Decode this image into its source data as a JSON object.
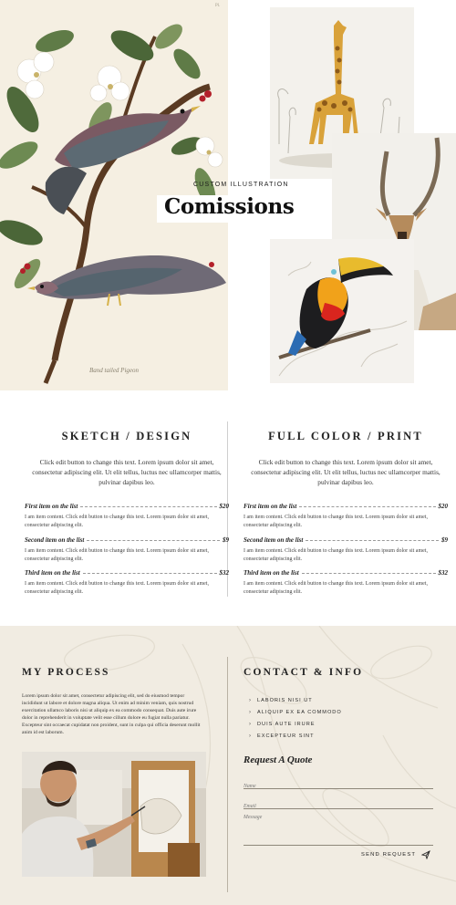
{
  "hero": {
    "kicker": "CUSTOM ILLUSTRATION",
    "title": "Comissions",
    "plate_caption": "Band tailed Pigeon",
    "plate_number": "Pl."
  },
  "pricing": {
    "columns": [
      {
        "title": "SKETCH / DESIGN",
        "intro": "Click edit button to change this text. Lorem ipsum dolor sit amet, consectetur adipiscing elit. Ut elit tellus, luctus nec ullamcorper mattis, pulvinar dapibus leo.",
        "items": [
          {
            "name": "First item on the list",
            "price": "$20",
            "desc": "I am item content. Click edit button to change this text. Lorem ipsum dolor sit amet, consectetur adipiscing elit."
          },
          {
            "name": "Second item on the list",
            "price": "$9",
            "desc": "I am item content. Click edit button to change this text. Lorem ipsum dolor sit amet, consectetur adipiscing elit."
          },
          {
            "name": "Third item on the list",
            "price": "$32",
            "desc": "I am item content. Click edit button to change this text. Lorem ipsum dolor sit amet, consectetur adipiscing elit."
          }
        ]
      },
      {
        "title": "FULL COLOR / PRINT",
        "intro": "Click edit button to change this text. Lorem ipsum dolor sit amet, consectetur adipiscing elit. Ut elit tellus, luctus nec ullamcorper mattis, pulvinar dapibus leo.",
        "items": [
          {
            "name": "First item on the list",
            "price": "$20",
            "desc": "I am item content. Click edit button to change this text. Lorem ipsum dolor sit amet, consectetur adipiscing elit."
          },
          {
            "name": "Second item on the list",
            "price": "$9",
            "desc": "I am item content. Click edit button to change this text. Lorem ipsum dolor sit amet, consectetur adipiscing elit."
          },
          {
            "name": "Third item on the list",
            "price": "$32",
            "desc": "I am item content. Click edit button to change this text. Lorem ipsum dolor sit amet, consectetur adipiscing elit."
          }
        ]
      }
    ]
  },
  "process": {
    "title": "MY PROCESS",
    "body": "Lorem ipsum dolor sit amet, consectetur adipiscing elit, sed do eiusmod tempor incididunt ut labore et dolore magna aliqua. Ut enim ad minim veniam, quis nostrud exercitation ullamco laboris nisi ut aliquip ex ea commodo consequat. Duis aute irure dolor in reprehenderit in voluptate velit esse cillum dolore eu fugiat nulla pariatur. Excepteur sint occaecat cupidatat non proident, sunt in culpa qui officia deserunt mollit anim id est laborum."
  },
  "contact": {
    "title": "CONTACT & INFO",
    "list": [
      "LABORIS NISI UT",
      "ALIQUIP EX EA COMMODO",
      "DUIS AUTE IRURE",
      "EXCEPTEUR SINT"
    ],
    "quote_title": "Request A Quote",
    "name_placeholder": "Name",
    "email_placeholder": "Email",
    "message_placeholder": "Message",
    "send_label": "SEND REQUEST"
  },
  "icons": {
    "chevron": "chevron-right-icon",
    "send": "paper-plane-icon"
  },
  "colors": {
    "page_bg": "#ffffff",
    "plate_bg": "#f5efe2",
    "section_bg": "#f1ece2",
    "text": "#222222",
    "divider": "#cfcfcf"
  }
}
